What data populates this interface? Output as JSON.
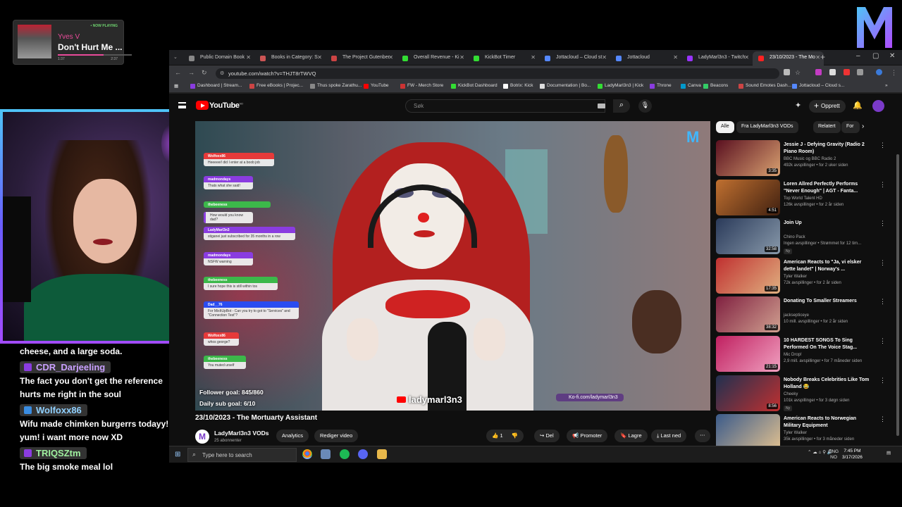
{
  "now_playing": {
    "badge": "• NOW PLAYING",
    "artist": "Yves V",
    "song": "Don't Hurt Me ...",
    "elapsed": "1:37",
    "duration": "2:37",
    "progress": 0.62
  },
  "chat": {
    "messages": [
      {
        "text": "cheese, and a large soda."
      },
      {
        "user": "CDR_Darjeeling",
        "color": "#b67bff",
        "text": "The fact you don't get the reference hurts me right in the soul"
      },
      {
        "user": "Wolfoxx86",
        "color": "#5ab8ff",
        "text": "Wifu made chimken burgerrs todayy! yum! i want more now XD"
      },
      {
        "user": "TRIQSZtm",
        "color": "#6ae06a",
        "text": "The big smoke meal lol"
      }
    ]
  },
  "browser": {
    "tabs": [
      {
        "title": "Public Domain Book",
        "color": "#888"
      },
      {
        "title": "Books in Category: S",
        "color": "#c55"
      },
      {
        "title": "The Project Gutenber",
        "color": "#c44"
      },
      {
        "title": "Overall Revenue - Ki",
        "color": "#3d3"
      },
      {
        "title": "KickBot Timer",
        "color": "#3d3"
      },
      {
        "title": "Jottacloud – Cloud st",
        "color": "#58f"
      },
      {
        "title": "Jottacloud",
        "color": "#58f"
      },
      {
        "title": "LadyMarl3n3 - Twitch",
        "color": "#93f"
      },
      {
        "title": "23/10/2023 - The Mo",
        "color": "#f22"
      }
    ],
    "url": "youtube.com/watch?v=THJT8rTWVQ",
    "bookmarks": [
      "Dashboard | Stream...",
      "Free eBooks | Projec...",
      "Thus spoke Zarathu...",
      "YouTube",
      "FW - Merch Store",
      "KickBot Dashboard",
      "Botrix: Kick",
      "Documentation | Bo...",
      "LadyMarl3n3 | Kick",
      "Throne",
      "Canva",
      "Beacons",
      "Sound Emotes Dash...",
      "Jottacloud – Cloud s..."
    ]
  },
  "youtube": {
    "brand": "YouTube",
    "region": "NO",
    "search_placeholder": "Søk",
    "create_label": "Opprett",
    "video_title": "23/10/2023 - The Mortuarty Assistant",
    "channel_name": "LadyMarl3n3 VODs",
    "subscribers": "25 abonnenter",
    "buttons": {
      "analytics": "Analytics",
      "edit": "Rediger video",
      "likes": "1",
      "share": "Del",
      "promote": "Promoter",
      "save": "Lagre",
      "download": "Last ned"
    },
    "overlay": {
      "follower_goal": "Follower goal: 845/860",
      "sub_goal": "Daily sub goal: 6/10",
      "channel_tag": "ladymarl3n3",
      "kofi": "Ko-fi.com/ladymarl3n3",
      "chat": [
        {
          "user": "Wolfoxx86",
          "color": "#e63a3a",
          "text": "Heeeeei! did I enter at a boob job"
        },
        {
          "user": "madmondays",
          "color": "#8a3ce0",
          "text": "Thats what she said!"
        },
        {
          "user": "thebeeness",
          "color": "#3cb84a",
          "text": ""
        },
        {
          "user": "",
          "color": "#8a3ce0",
          "text": "How would you know dad?"
        },
        {
          "user": "LadyMarl3n3",
          "color": "#8a3ce0",
          "text": "stiganei just subscribed for 35 months in a row"
        },
        {
          "user": "madmondays",
          "color": "#8a3ce0",
          "text": "NSFW warning"
        },
        {
          "user": "thebeeness",
          "color": "#3cb84a",
          "text": "I sure hope this is still within tos"
        },
        {
          "user": "Dad__76",
          "color": "#2a4cf0",
          "text": "For MixItUpBot - Can you try to got to \"Services\" and \"Connection Test\"?"
        },
        {
          "user": "Wolfoxx86",
          "color": "#e63a3a",
          "text": "whos george?"
        },
        {
          "user": "thebeeness",
          "color": "#3cb84a",
          "text": "You muted urself"
        }
      ]
    },
    "chips": [
      "Alle",
      "Fra LadyMarl3n3 VODs",
      "Relatert",
      "For"
    ],
    "recs": [
      {
        "title": "Jessie J - Defying Gravity (Radio 2 Piano Room)",
        "channel": "BBC Music og BBC Radio 2",
        "meta": "492k avspillinger • for 2 uker siden",
        "dur": "3:35",
        "c1": "#5a1020",
        "c2": "#d8a070",
        "ny": ""
      },
      {
        "title": "Loren Allred Perfectly Performs \"Never Enough\" | AGT - Fanta...",
        "channel": "Top World Talent HD",
        "meta": "126k avspillinger • for 2 år siden",
        "dur": "4:51",
        "c1": "#c07030",
        "c2": "#402010",
        "ny": ""
      },
      {
        "title": "Join Up",
        "channel": "Chino Pack",
        "meta": "Ingen avspillinger • Strømmet for 12 tim...",
        "dur": "32:58",
        "c1": "#2a3a5a",
        "c2": "#8899aa",
        "ny": "Ny"
      },
      {
        "title": "American Reacts to \"Ja, vi elsker dette landet\" | Norway's ...",
        "channel": "Tyler Walker",
        "meta": "72k avspillinger • for 2 år siden",
        "dur": "17:35",
        "c1": "#c03030",
        "c2": "#e0b080",
        "ny": ""
      },
      {
        "title": "Donating To Smaller Streamers",
        "channel": "jacksepticeye",
        "meta": "10 mill. avspillinger • for 2 år siden",
        "dur": "38:32",
        "c1": "#802040",
        "c2": "#d0a090",
        "ny": ""
      },
      {
        "title": "10 HARDEST SONGS To Sing Performed On The Voice Stag...",
        "channel": "Mic Drop!",
        "meta": "2,9 mill. avspillinger • for 7 måneder siden",
        "dur": "21:15",
        "c1": "#c02060",
        "c2": "#f0a0c0",
        "ny": ""
      },
      {
        "title": "Nobody Breaks Celebrities Like Tom Holland 😂",
        "channel": "Cheeky",
        "meta": "101k avspillinger • for 3 døgn siden",
        "dur": "8:56",
        "c1": "#203050",
        "c2": "#c03030",
        "ny": "Ny"
      },
      {
        "title": "American Reacts to Norwegian Military Equipment",
        "channel": "Tyler Walker",
        "meta": "35k avspillinger • for 3 måneder siden",
        "dur": "",
        "c1": "#3a5a8a",
        "c2": "#e0c090",
        "ny": ""
      }
    ]
  },
  "taskbar": {
    "search_placeholder": "Type here to search",
    "lang": "ENG",
    "region": "NO",
    "time": "7:45 PM",
    "date": "3/17/2026"
  }
}
